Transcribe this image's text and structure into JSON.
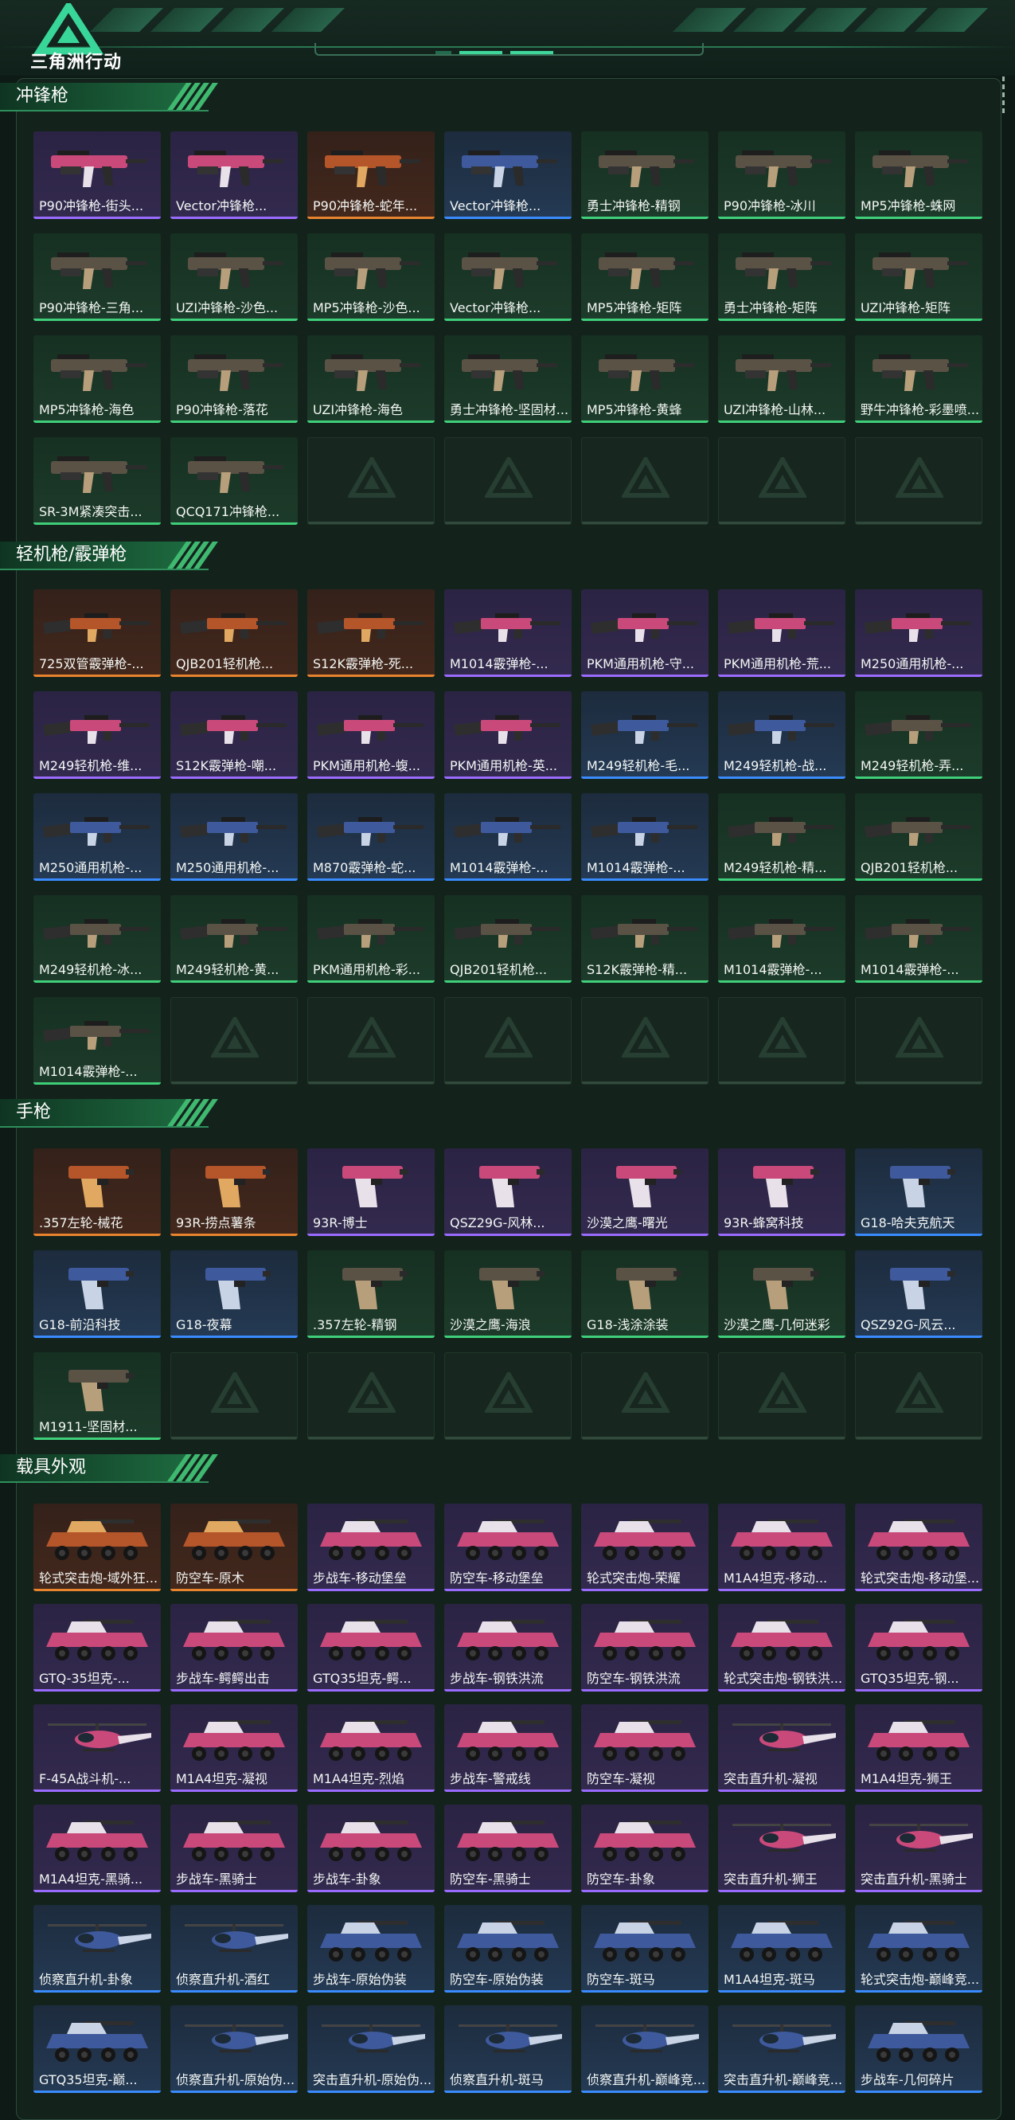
{
  "header": {
    "logo_text": "三角洲行动"
  },
  "sections": [
    {
      "key": "smg",
      "title": "冲锋枪",
      "items": [
        {
          "name": "P90冲锋枪-街头...",
          "rarity": "purple",
          "icon": "smg"
        },
        {
          "name": "Vector冲锋枪...",
          "rarity": "purple",
          "icon": "smg"
        },
        {
          "name": "P90冲锋枪-蛇年...",
          "rarity": "orange",
          "icon": "smg"
        },
        {
          "name": "Vector冲锋枪...",
          "rarity": "blue",
          "icon": "smg"
        },
        {
          "name": "勇士冲锋枪-精钢",
          "rarity": "green",
          "icon": "smg"
        },
        {
          "name": "P90冲锋枪-冰川",
          "rarity": "green",
          "icon": "smg"
        },
        {
          "name": "MP5冲锋枪-蛛网",
          "rarity": "green",
          "icon": "smg"
        },
        {
          "name": "P90冲锋枪-三角...",
          "rarity": "green",
          "icon": "smg"
        },
        {
          "name": "UZI冲锋枪-沙色...",
          "rarity": "green",
          "icon": "smg"
        },
        {
          "name": "MP5冲锋枪-沙色...",
          "rarity": "green",
          "icon": "smg"
        },
        {
          "name": "Vector冲锋枪...",
          "rarity": "green",
          "icon": "smg"
        },
        {
          "name": "MP5冲锋枪-矩阵",
          "rarity": "green",
          "icon": "smg"
        },
        {
          "name": "勇士冲锋枪-矩阵",
          "rarity": "green",
          "icon": "smg"
        },
        {
          "name": "UZI冲锋枪-矩阵",
          "rarity": "green",
          "icon": "smg"
        },
        {
          "name": "MP5冲锋枪-海色",
          "rarity": "green",
          "icon": "smg"
        },
        {
          "name": "P90冲锋枪-落花",
          "rarity": "green",
          "icon": "smg"
        },
        {
          "name": "UZI冲锋枪-海色",
          "rarity": "green",
          "icon": "smg"
        },
        {
          "name": "勇士冲锋枪-坚固材...",
          "rarity": "green",
          "icon": "smg"
        },
        {
          "name": "MP5冲锋枪-黄蜂",
          "rarity": "green",
          "icon": "smg"
        },
        {
          "name": "UZI冲锋枪-山林...",
          "rarity": "green",
          "icon": "smg"
        },
        {
          "name": "野牛冲锋枪-彩墨喷...",
          "rarity": "green",
          "icon": "smg"
        },
        {
          "name": "SR-3M紧凑突击...",
          "rarity": "green",
          "icon": "smg"
        },
        {
          "name": "QCQ171冲锋枪...",
          "rarity": "green",
          "icon": "smg"
        }
      ],
      "empty": 5
    },
    {
      "key": "lmg",
      "title": "轻机枪/霰弹枪",
      "items": [
        {
          "name": "725双管霰弹枪-...",
          "rarity": "orange",
          "icon": "rifle"
        },
        {
          "name": "QJB201轻机枪...",
          "rarity": "orange",
          "icon": "rifle"
        },
        {
          "name": "S12K霰弹枪-死...",
          "rarity": "orange",
          "icon": "rifle"
        },
        {
          "name": "M1014霰弹枪-...",
          "rarity": "purple",
          "icon": "rifle"
        },
        {
          "name": "PKM通用机枪-守...",
          "rarity": "purple",
          "icon": "rifle"
        },
        {
          "name": "PKM通用机枪-荒...",
          "rarity": "purple",
          "icon": "rifle"
        },
        {
          "name": "M250通用机枪-...",
          "rarity": "purple",
          "icon": "rifle"
        },
        {
          "name": "M249轻机枪-维...",
          "rarity": "purple",
          "icon": "rifle"
        },
        {
          "name": "S12K霰弹枪-嘲...",
          "rarity": "purple",
          "icon": "rifle"
        },
        {
          "name": "PKM通用机枪-蝮...",
          "rarity": "purple",
          "icon": "rifle"
        },
        {
          "name": "PKM通用机枪-英...",
          "rarity": "purple",
          "icon": "rifle"
        },
        {
          "name": "M249轻机枪-毛...",
          "rarity": "blue",
          "icon": "rifle"
        },
        {
          "name": "M249轻机枪-战...",
          "rarity": "blue",
          "icon": "rifle"
        },
        {
          "name": "M249轻机枪-弄...",
          "rarity": "green",
          "icon": "rifle"
        },
        {
          "name": "M250通用机枪-...",
          "rarity": "blue",
          "icon": "rifle"
        },
        {
          "name": "M250通用机枪-...",
          "rarity": "blue",
          "icon": "rifle"
        },
        {
          "name": "M870霰弹枪-蛇...",
          "rarity": "blue",
          "icon": "rifle"
        },
        {
          "name": "M1014霰弹枪-...",
          "rarity": "blue",
          "icon": "rifle"
        },
        {
          "name": "M1014霰弹枪-...",
          "rarity": "blue",
          "icon": "rifle"
        },
        {
          "name": "M249轻机枪-精...",
          "rarity": "green",
          "icon": "rifle"
        },
        {
          "name": "QJB201轻机枪...",
          "rarity": "green",
          "icon": "rifle"
        },
        {
          "name": "M249轻机枪-冰...",
          "rarity": "green",
          "icon": "rifle"
        },
        {
          "name": "M249轻机枪-黄...",
          "rarity": "green",
          "icon": "rifle"
        },
        {
          "name": "PKM通用机枪-彩...",
          "rarity": "green",
          "icon": "rifle"
        },
        {
          "name": "QJB201轻机枪...",
          "rarity": "green",
          "icon": "rifle"
        },
        {
          "name": "S12K霰弹枪-精...",
          "rarity": "green",
          "icon": "rifle"
        },
        {
          "name": "M1014霰弹枪-...",
          "rarity": "green",
          "icon": "rifle"
        },
        {
          "name": "M1014霰弹枪-...",
          "rarity": "green",
          "icon": "rifle"
        },
        {
          "name": "M1014霰弹枪-...",
          "rarity": "green",
          "icon": "rifle"
        }
      ],
      "empty": 6
    },
    {
      "key": "pistol",
      "title": "手枪",
      "items": [
        {
          "name": ".357左轮-械花",
          "rarity": "orange",
          "icon": "pistol"
        },
        {
          "name": "93R-捞点薯条",
          "rarity": "orange",
          "icon": "pistol"
        },
        {
          "name": "93R-博士",
          "rarity": "purple",
          "icon": "pistol"
        },
        {
          "name": "QSZ29G-风林...",
          "rarity": "purple",
          "icon": "pistol"
        },
        {
          "name": "沙漠之鹰-曙光",
          "rarity": "purple",
          "icon": "pistol"
        },
        {
          "name": "93R-蜂窝科技",
          "rarity": "purple",
          "icon": "pistol"
        },
        {
          "name": "G18-哈夫克航天",
          "rarity": "blue",
          "icon": "pistol"
        },
        {
          "name": "G18-前沿科技",
          "rarity": "blue",
          "icon": "pistol"
        },
        {
          "name": "G18-夜幕",
          "rarity": "blue",
          "icon": "pistol"
        },
        {
          "name": ".357左轮-精钢",
          "rarity": "green",
          "icon": "pistol"
        },
        {
          "name": "沙漠之鹰-海浪",
          "rarity": "green",
          "icon": "pistol"
        },
        {
          "name": "G18-浅涂涂装",
          "rarity": "green",
          "icon": "pistol"
        },
        {
          "name": "沙漠之鹰-几何迷彩",
          "rarity": "green",
          "icon": "pistol"
        },
        {
          "name": "QSZ92G-风云...",
          "rarity": "blue",
          "icon": "pistol"
        },
        {
          "name": "M1911-坚固材...",
          "rarity": "green",
          "icon": "pistol"
        }
      ],
      "empty": 6
    },
    {
      "key": "vehicle",
      "title": "载具外观",
      "items": [
        {
          "name": "轮式突击炮-域外狂...",
          "rarity": "orange",
          "icon": "vehicle"
        },
        {
          "name": "防空车-原木",
          "rarity": "orange",
          "icon": "vehicle"
        },
        {
          "name": "步战车-移动堡垒",
          "rarity": "purple",
          "icon": "vehicle"
        },
        {
          "name": "防空车-移动堡垒",
          "rarity": "purple",
          "icon": "vehicle"
        },
        {
          "name": "轮式突击炮-荣耀",
          "rarity": "purple",
          "icon": "vehicle"
        },
        {
          "name": "M1A4坦克-移动...",
          "rarity": "purple",
          "icon": "vehicle"
        },
        {
          "name": "轮式突击炮-移动堡...",
          "rarity": "purple",
          "icon": "vehicle"
        },
        {
          "name": "GTQ-35坦克-...",
          "rarity": "purple",
          "icon": "vehicle"
        },
        {
          "name": "步战车-鳄鳄出击",
          "rarity": "purple",
          "icon": "vehicle"
        },
        {
          "name": "GTQ35坦克-鳄...",
          "rarity": "purple",
          "icon": "vehicle"
        },
        {
          "name": "步战车-钢铁洪流",
          "rarity": "purple",
          "icon": "vehicle"
        },
        {
          "name": "防空车-钢铁洪流",
          "rarity": "purple",
          "icon": "vehicle"
        },
        {
          "name": "轮式突击炮-钢铁洪...",
          "rarity": "purple",
          "icon": "vehicle"
        },
        {
          "name": "GTQ35坦克-钢...",
          "rarity": "purple",
          "icon": "vehicle"
        },
        {
          "name": "F-45A战斗机-...",
          "rarity": "purple",
          "icon": "aircraft"
        },
        {
          "name": "M1A4坦克-凝视",
          "rarity": "purple",
          "icon": "vehicle"
        },
        {
          "name": "M1A4坦克-烈焰",
          "rarity": "purple",
          "icon": "vehicle"
        },
        {
          "name": "步战车-警戒线",
          "rarity": "purple",
          "icon": "vehicle"
        },
        {
          "name": "防空车-凝视",
          "rarity": "purple",
          "icon": "vehicle"
        },
        {
          "name": "突击直升机-凝视",
          "rarity": "purple",
          "icon": "aircraft"
        },
        {
          "name": "M1A4坦克-狮王",
          "rarity": "purple",
          "icon": "vehicle"
        },
        {
          "name": "M1A4坦克-黑骑...",
          "rarity": "purple",
          "icon": "vehicle"
        },
        {
          "name": "步战车-黑骑士",
          "rarity": "purple",
          "icon": "vehicle"
        },
        {
          "name": "步战车-卦象",
          "rarity": "purple",
          "icon": "vehicle"
        },
        {
          "name": "防空车-黑骑士",
          "rarity": "purple",
          "icon": "vehicle"
        },
        {
          "name": "防空车-卦象",
          "rarity": "purple",
          "icon": "vehicle"
        },
        {
          "name": "突击直升机-狮王",
          "rarity": "purple",
          "icon": "aircraft"
        },
        {
          "name": "突击直升机-黑骑士",
          "rarity": "purple",
          "icon": "aircraft"
        },
        {
          "name": "侦察直升机-卦象",
          "rarity": "blue",
          "icon": "aircraft"
        },
        {
          "name": "侦察直升机-酒红",
          "rarity": "blue",
          "icon": "aircraft"
        },
        {
          "name": "步战车-原始伪装",
          "rarity": "blue",
          "icon": "vehicle"
        },
        {
          "name": "防空车-原始伪装",
          "rarity": "blue",
          "icon": "vehicle"
        },
        {
          "name": "防空车-斑马",
          "rarity": "blue",
          "icon": "vehicle"
        },
        {
          "name": "M1A4坦克-斑马",
          "rarity": "blue",
          "icon": "vehicle"
        },
        {
          "name": "轮式突击炮-巅峰竞...",
          "rarity": "blue",
          "icon": "vehicle"
        },
        {
          "name": "GTQ35坦克-巅...",
          "rarity": "blue",
          "icon": "vehicle"
        },
        {
          "name": "侦察直升机-原始伪...",
          "rarity": "blue",
          "icon": "aircraft"
        },
        {
          "name": "突击直升机-原始伪...",
          "rarity": "blue",
          "icon": "aircraft"
        },
        {
          "name": "侦察直升机-斑马",
          "rarity": "blue",
          "icon": "aircraft"
        },
        {
          "name": "侦察直升机-巅峰竞...",
          "rarity": "blue",
          "icon": "aircraft"
        },
        {
          "name": "突击直升机-巅峰竞...",
          "rarity": "blue",
          "icon": "aircraft"
        },
        {
          "name": "步战车-几何碎片",
          "rarity": "blue",
          "icon": "vehicle"
        }
      ],
      "empty": 0
    }
  ],
  "colors": {
    "purple": "#9a6bff",
    "blue": "#3a8bff",
    "green": "#3fcf7a",
    "orange": "#e8832e"
  }
}
